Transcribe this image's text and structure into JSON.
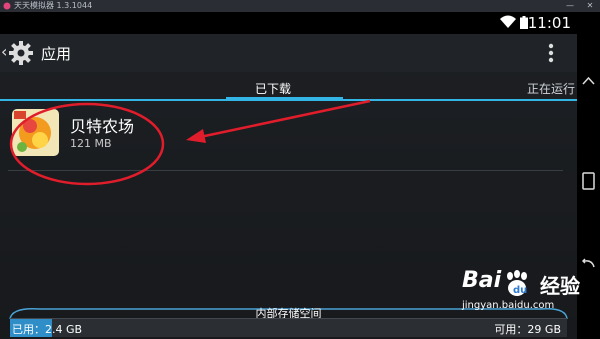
{
  "emulator": {
    "title": "天天模拟器 1.3.1044",
    "minimize": "—",
    "close": "✕"
  },
  "status_bar": {
    "time": "11:01"
  },
  "action_bar": {
    "title": "应用"
  },
  "tabs": [
    {
      "label": "已下载",
      "selected": true
    },
    {
      "label": "正在运行",
      "selected": false
    }
  ],
  "app": {
    "name": "贝特农场",
    "size": "121 MB"
  },
  "storage": {
    "title": "内部存储空间",
    "used": "已用：2.4 GB",
    "free": "可用：29 GB",
    "used_fraction": 0.076
  },
  "watermark": {
    "brand": "Bai",
    "brand2": "经验",
    "url": "jingyan.baidu.com"
  },
  "colors": {
    "accent": "#33b5e5",
    "annotation": "#e11d2b",
    "background": "#1b1d21"
  }
}
